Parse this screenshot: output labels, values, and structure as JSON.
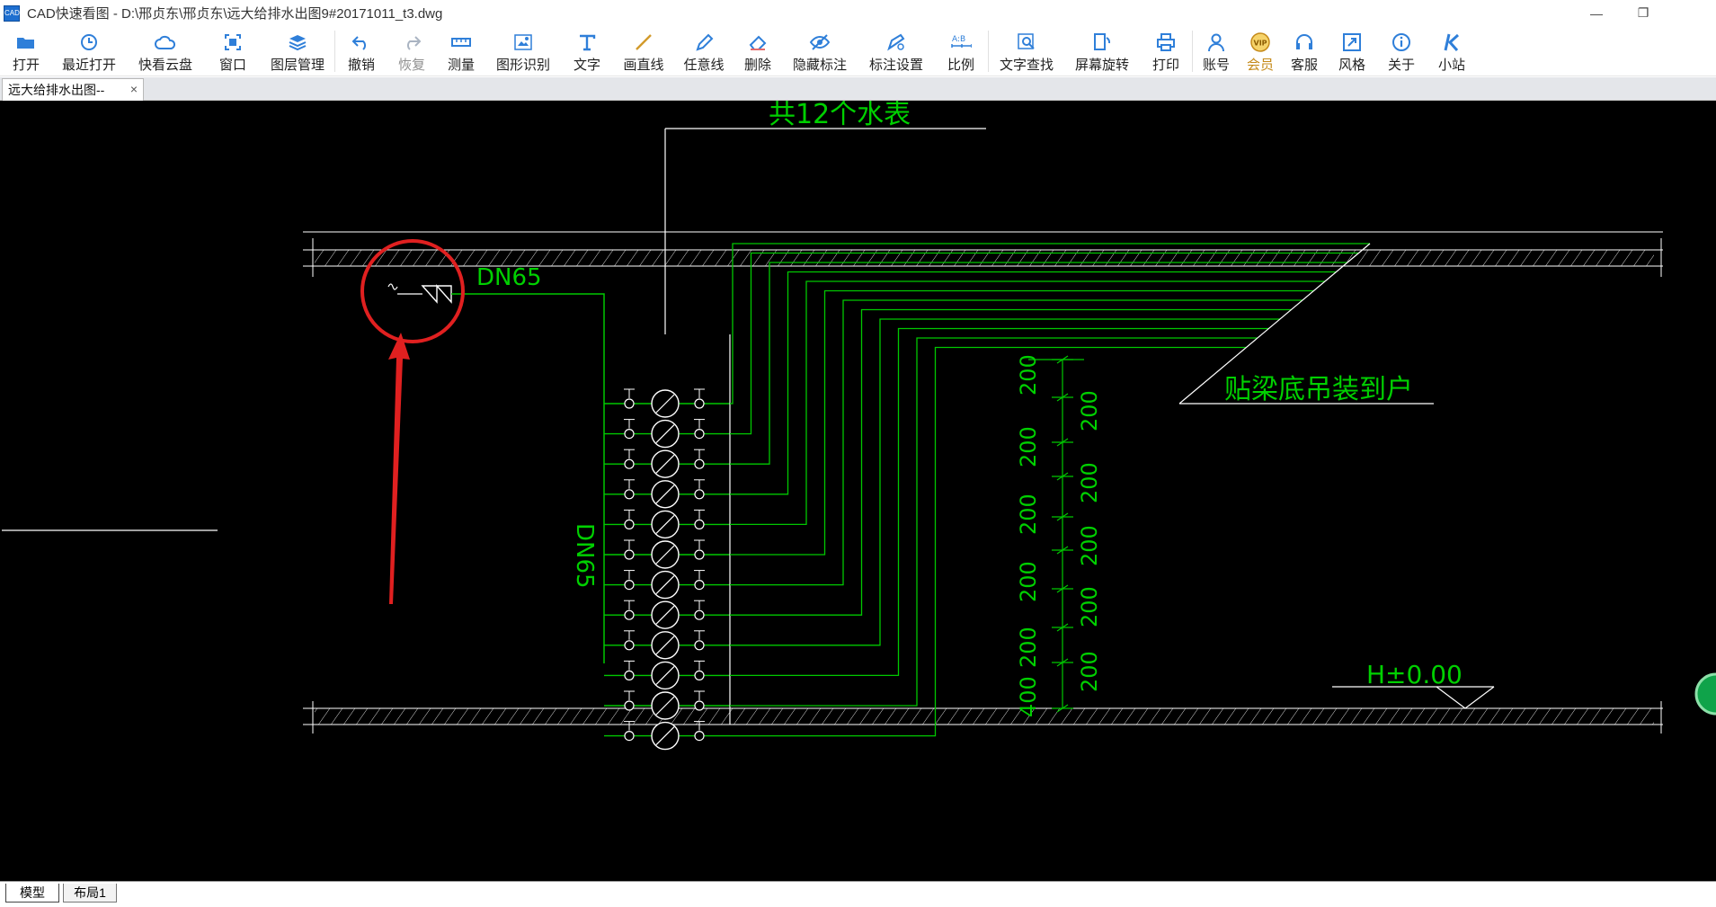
{
  "window": {
    "title": "CAD快速看图 - D:\\邢贞东\\邢贞东\\远大给排水出图9#20171011_t3.dwg",
    "app_icon_text": "CAD",
    "minimize": "—",
    "restore": "❐"
  },
  "toolbar": {
    "buttons": [
      {
        "label": "打开",
        "icon": "folder-open-icon"
      },
      {
        "label": "最近打开",
        "icon": "clock-icon"
      },
      {
        "label": "快看云盘",
        "icon": "cloud-icon"
      },
      {
        "label": "窗口",
        "icon": "window-icon"
      },
      {
        "label": "图层管理",
        "icon": "layers-icon"
      },
      {
        "label": "撤销",
        "icon": "undo-icon"
      },
      {
        "label": "恢复",
        "icon": "redo-icon"
      },
      {
        "label": "测量",
        "icon": "ruler-icon"
      },
      {
        "label": "图形识别",
        "icon": "shape-recognize-icon"
      },
      {
        "label": "文字",
        "icon": "text-icon"
      },
      {
        "label": "画直线",
        "icon": "line-icon"
      },
      {
        "label": "任意线",
        "icon": "pencil-icon"
      },
      {
        "label": "删除",
        "icon": "eraser-icon"
      },
      {
        "label": "隐藏标注",
        "icon": "eye-off-icon"
      },
      {
        "label": "标注设置",
        "icon": "annotation-settings-icon"
      },
      {
        "label": "比例",
        "icon": "scale-icon"
      },
      {
        "label": "文字查找",
        "icon": "text-search-icon"
      },
      {
        "label": "屏幕旋转",
        "icon": "rotate-screen-icon"
      },
      {
        "label": "打印",
        "icon": "printer-icon"
      },
      {
        "label": "账号",
        "icon": "user-icon"
      },
      {
        "label": "会员",
        "icon": "vip-icon"
      },
      {
        "label": "客服",
        "icon": "headset-icon"
      },
      {
        "label": "风格",
        "icon": "style-icon"
      },
      {
        "label": "关于",
        "icon": "info-icon"
      },
      {
        "label": "小站",
        "icon": "k-site-icon"
      }
    ],
    "scale_icon_text": "A:B",
    "vip_icon_text": "VIP"
  },
  "document_tab": {
    "label": "远大给排水出图--",
    "close": "×"
  },
  "drawing": {
    "meter_note": "共12个水表",
    "pipe_label_top": "DN65",
    "pipe_label_vertical": "DN65",
    "beam_note": "贴梁底吊装到户",
    "elevation": "H±0.00",
    "dims_left": [
      "200",
      "200",
      "200",
      "200",
      "200",
      "400"
    ],
    "dims_right": [
      "200",
      "200",
      "200",
      "200",
      "200"
    ],
    "meter_count": 12,
    "colors": {
      "background": "#000000",
      "pipe": "#00c800",
      "linework": "#ffffff",
      "annotation": "#e02020"
    }
  },
  "layout_tabs": {
    "model": "模型",
    "layout1": "布局1"
  }
}
